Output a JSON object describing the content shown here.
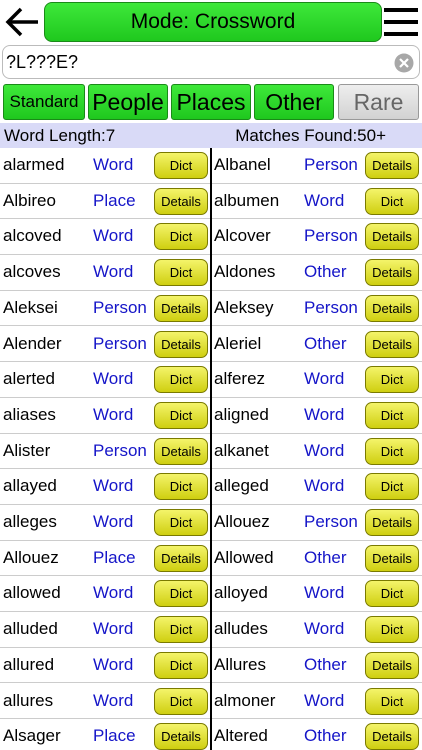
{
  "header": {
    "mode_label": "Mode: Crossword"
  },
  "search": {
    "value": "?L???E?"
  },
  "filters": [
    {
      "label": "Standard",
      "active": true
    },
    {
      "label": "People",
      "active": true
    },
    {
      "label": "Places",
      "active": true
    },
    {
      "label": "Other",
      "active": true
    },
    {
      "label": "Rare",
      "active": false
    }
  ],
  "info": {
    "word_length": "Word Length:7",
    "matches": "Matches Found:50+"
  },
  "colors": {
    "active_green": "#22cc22",
    "action_yellow": "#e6e62a",
    "type_blue": "#1515c8",
    "info_bg": "#d9daf7"
  },
  "rows": [
    {
      "left": {
        "word": "alarmed",
        "type": "Word",
        "action": "Dict"
      },
      "right": {
        "word": "Albanel",
        "type": "Person",
        "action": "Details"
      }
    },
    {
      "left": {
        "word": "Albireo",
        "type": "Place",
        "action": "Details"
      },
      "right": {
        "word": "albumen",
        "type": "Word",
        "action": "Dict"
      }
    },
    {
      "left": {
        "word": "alcoved",
        "type": "Word",
        "action": "Dict"
      },
      "right": {
        "word": "Alcover",
        "type": "Person",
        "action": "Details"
      }
    },
    {
      "left": {
        "word": "alcoves",
        "type": "Word",
        "action": "Dict"
      },
      "right": {
        "word": "Aldones",
        "type": "Other",
        "action": "Details"
      }
    },
    {
      "left": {
        "word": "Aleksei",
        "type": "Person",
        "action": "Details"
      },
      "right": {
        "word": "Aleksey",
        "type": "Person",
        "action": "Details"
      }
    },
    {
      "left": {
        "word": "Alender",
        "type": "Person",
        "action": "Details"
      },
      "right": {
        "word": "Aleriel",
        "type": "Other",
        "action": "Details"
      }
    },
    {
      "left": {
        "word": "alerted",
        "type": "Word",
        "action": "Dict"
      },
      "right": {
        "word": "alferez",
        "type": "Word",
        "action": "Dict"
      }
    },
    {
      "left": {
        "word": "aliases",
        "type": "Word",
        "action": "Dict"
      },
      "right": {
        "word": "aligned",
        "type": "Word",
        "action": "Dict"
      }
    },
    {
      "left": {
        "word": "Alister",
        "type": "Person",
        "action": "Details"
      },
      "right": {
        "word": "alkanet",
        "type": "Word",
        "action": "Dict"
      }
    },
    {
      "left": {
        "word": "allayed",
        "type": "Word",
        "action": "Dict"
      },
      "right": {
        "word": "alleged",
        "type": "Word",
        "action": "Dict"
      }
    },
    {
      "left": {
        "word": "alleges",
        "type": "Word",
        "action": "Dict"
      },
      "right": {
        "word": "Allouez",
        "type": "Person",
        "action": "Details"
      }
    },
    {
      "left": {
        "word": "Allouez",
        "type": "Place",
        "action": "Details"
      },
      "right": {
        "word": "Allowed",
        "type": "Other",
        "action": "Details"
      }
    },
    {
      "left": {
        "word": "allowed",
        "type": "Word",
        "action": "Dict"
      },
      "right": {
        "word": "alloyed",
        "type": "Word",
        "action": "Dict"
      }
    },
    {
      "left": {
        "word": "alluded",
        "type": "Word",
        "action": "Dict"
      },
      "right": {
        "word": "alludes",
        "type": "Word",
        "action": "Dict"
      }
    },
    {
      "left": {
        "word": "allured",
        "type": "Word",
        "action": "Dict"
      },
      "right": {
        "word": "Allures",
        "type": "Other",
        "action": "Details"
      }
    },
    {
      "left": {
        "word": "allures",
        "type": "Word",
        "action": "Dict"
      },
      "right": {
        "word": "almoner",
        "type": "Word",
        "action": "Dict"
      }
    },
    {
      "left": {
        "word": "Alsager",
        "type": "Place",
        "action": "Details"
      },
      "right": {
        "word": "Altered",
        "type": "Other",
        "action": "Details"
      }
    }
  ]
}
